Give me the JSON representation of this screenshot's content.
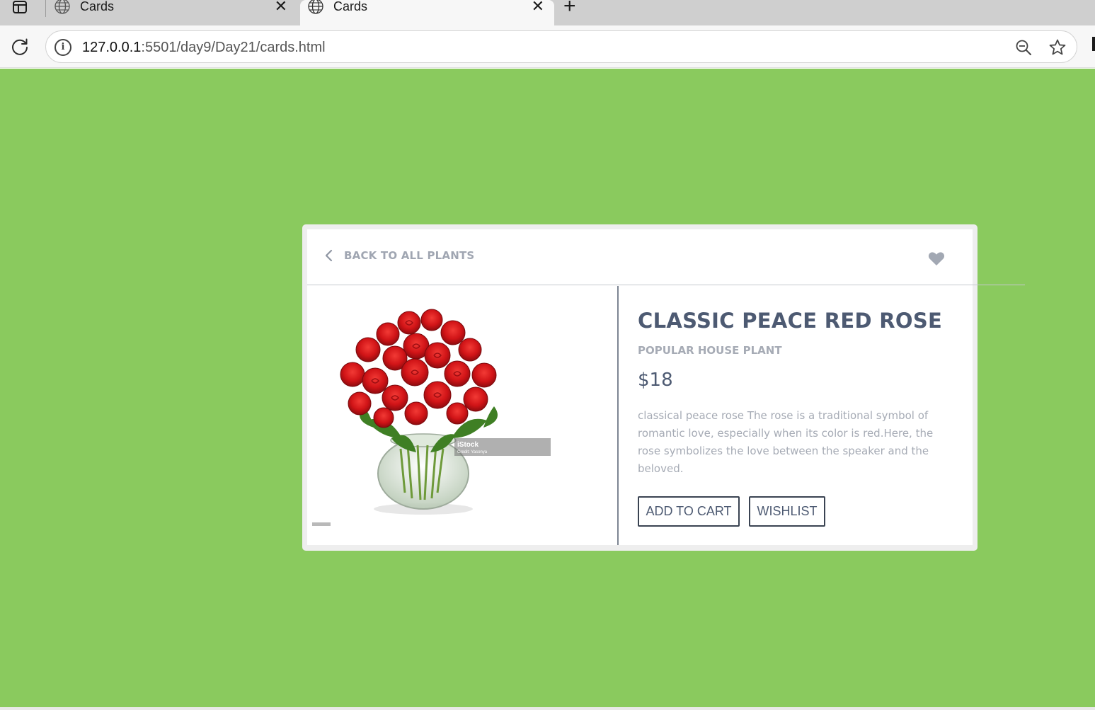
{
  "browser": {
    "tabs": [
      {
        "title": "Cards",
        "active": false
      },
      {
        "title": "Cards",
        "active": true
      }
    ],
    "address": {
      "host": "127.0.0.1",
      "path": ":5501/day9/Day21/cards.html"
    }
  },
  "colors": {
    "page_background": "#8aca5e",
    "title_text": "#4d5a72",
    "muted_text": "#a6abb5",
    "button_border": "#3a4352",
    "rose_red": "#d11417"
  },
  "card": {
    "back_label": "BACK TO ALL PLANTS",
    "heart_icon": "heart-icon",
    "product": {
      "title": "CLASSIC PEACE RED ROSE",
      "subtitle": "POPULAR HOUSE PLANT",
      "price": "$18",
      "description": "classical peace rose The rose is a traditional symbol of romantic love, especially when its color is red.Here, the rose symbolizes the love between the speaker and the beloved.",
      "image_watermark": "iStock",
      "image_credit": "Credit: Yasonya"
    },
    "buttons": {
      "add_to_cart": "ADD TO CART",
      "wishlist": "WISHLIST"
    }
  }
}
